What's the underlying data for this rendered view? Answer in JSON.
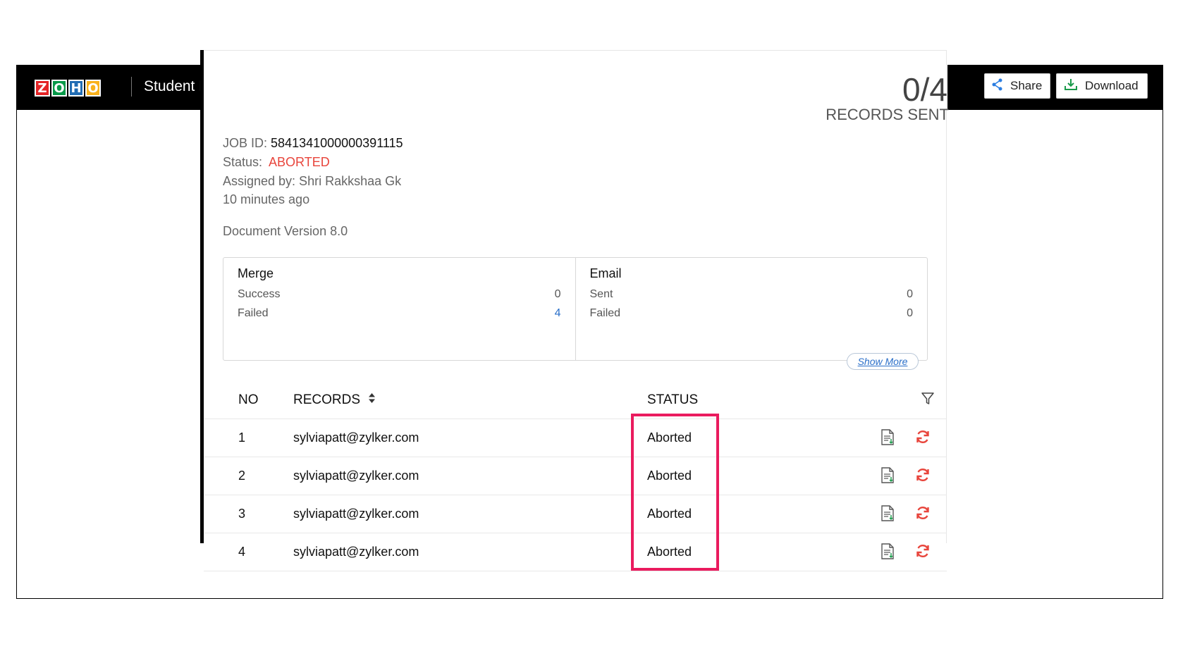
{
  "header": {
    "logo_letters": [
      "Z",
      "O",
      "H",
      "O"
    ],
    "logo_colors": [
      "#e42527",
      "#089949",
      "#226db4",
      "#f9b21d"
    ],
    "title": "Student Promotion letter",
    "share_label": "Share",
    "download_label": "Download"
  },
  "job": {
    "id_label": "JOB ID:",
    "id_value": "5841341000000391115",
    "status_label": "Status:",
    "status_value": "ABORTED",
    "assigned_by": "Assigned by: Shri Rakkshaa Gk",
    "time_ago": "10 minutes ago",
    "doc_version": "Document Version 8.0",
    "records_count": "0/4",
    "records_label": "RECORDS SENT"
  },
  "summary": {
    "merge": {
      "title": "Merge",
      "rows": [
        {
          "label": "Success",
          "value": "0"
        },
        {
          "label": "Failed",
          "value": "4"
        }
      ]
    },
    "email": {
      "title": "Email",
      "rows": [
        {
          "label": "Sent",
          "value": "0"
        },
        {
          "label": "Failed",
          "value": "0"
        }
      ]
    },
    "show_more": "Show More"
  },
  "table": {
    "headers": {
      "no": "NO",
      "records": "RECORDS",
      "status": "STATUS"
    },
    "rows": [
      {
        "no": "1",
        "record": "sylviapatt@zylker.com",
        "status": "Aborted"
      },
      {
        "no": "2",
        "record": "sylviapatt@zylker.com",
        "status": "Aborted"
      },
      {
        "no": "3",
        "record": "sylviapatt@zylker.com",
        "status": "Aborted"
      },
      {
        "no": "4",
        "record": "sylviapatt@zylker.com",
        "status": "Aborted"
      }
    ]
  },
  "icons": {
    "share": "share-icon",
    "download": "download-icon",
    "sort": "sort-icon",
    "filter": "filter-icon",
    "document": "document-icon",
    "retry": "refresh-icon"
  },
  "colors": {
    "status_aborted": "#e8453c",
    "highlight": "#ea1b5e",
    "link": "#2a6fc9"
  }
}
